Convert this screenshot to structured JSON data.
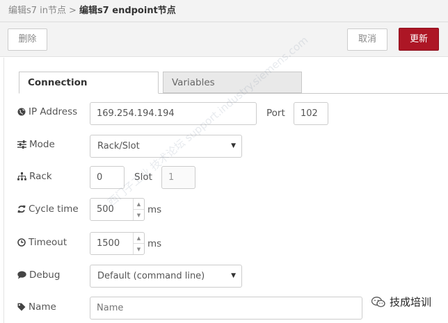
{
  "breadcrumb": {
    "parent": "编辑s7 in节点",
    "separator": ">",
    "current": "编辑s7 endpoint节点"
  },
  "toolbar": {
    "delete_label": "删除",
    "cancel_label": "取消",
    "update_label": "更新",
    "accent_color": "#ad1625"
  },
  "tabs": [
    {
      "label": "Connection",
      "active": true
    },
    {
      "label": "Variables",
      "active": false
    }
  ],
  "form": {
    "ip": {
      "label": "IP Address",
      "value": "169.254.194.194",
      "icon": "globe-icon"
    },
    "port": {
      "label": "Port",
      "value": "102"
    },
    "mode": {
      "label": "Mode",
      "value": "Rack/Slot",
      "icon": "sliders-icon"
    },
    "rack": {
      "label": "Rack",
      "value": "0",
      "icon": "sitemap-icon"
    },
    "slot": {
      "label": "Slot",
      "value": "1"
    },
    "cycle_time": {
      "label": "Cycle time",
      "value": "500",
      "unit": "ms",
      "icon": "refresh-icon"
    },
    "timeout": {
      "label": "Timeout",
      "value": "1500",
      "unit": "ms",
      "icon": "clock-icon"
    },
    "debug": {
      "label": "Debug",
      "value": "Default (command line)",
      "icon": "speech-bubble-icon"
    },
    "name": {
      "label": "Name",
      "placeholder": "Name",
      "icon": "tag-icon"
    }
  },
  "overlay": {
    "watermark": "西门子工业 技术论坛 support.industry.siemens.com",
    "badge_text": "技成培训"
  }
}
